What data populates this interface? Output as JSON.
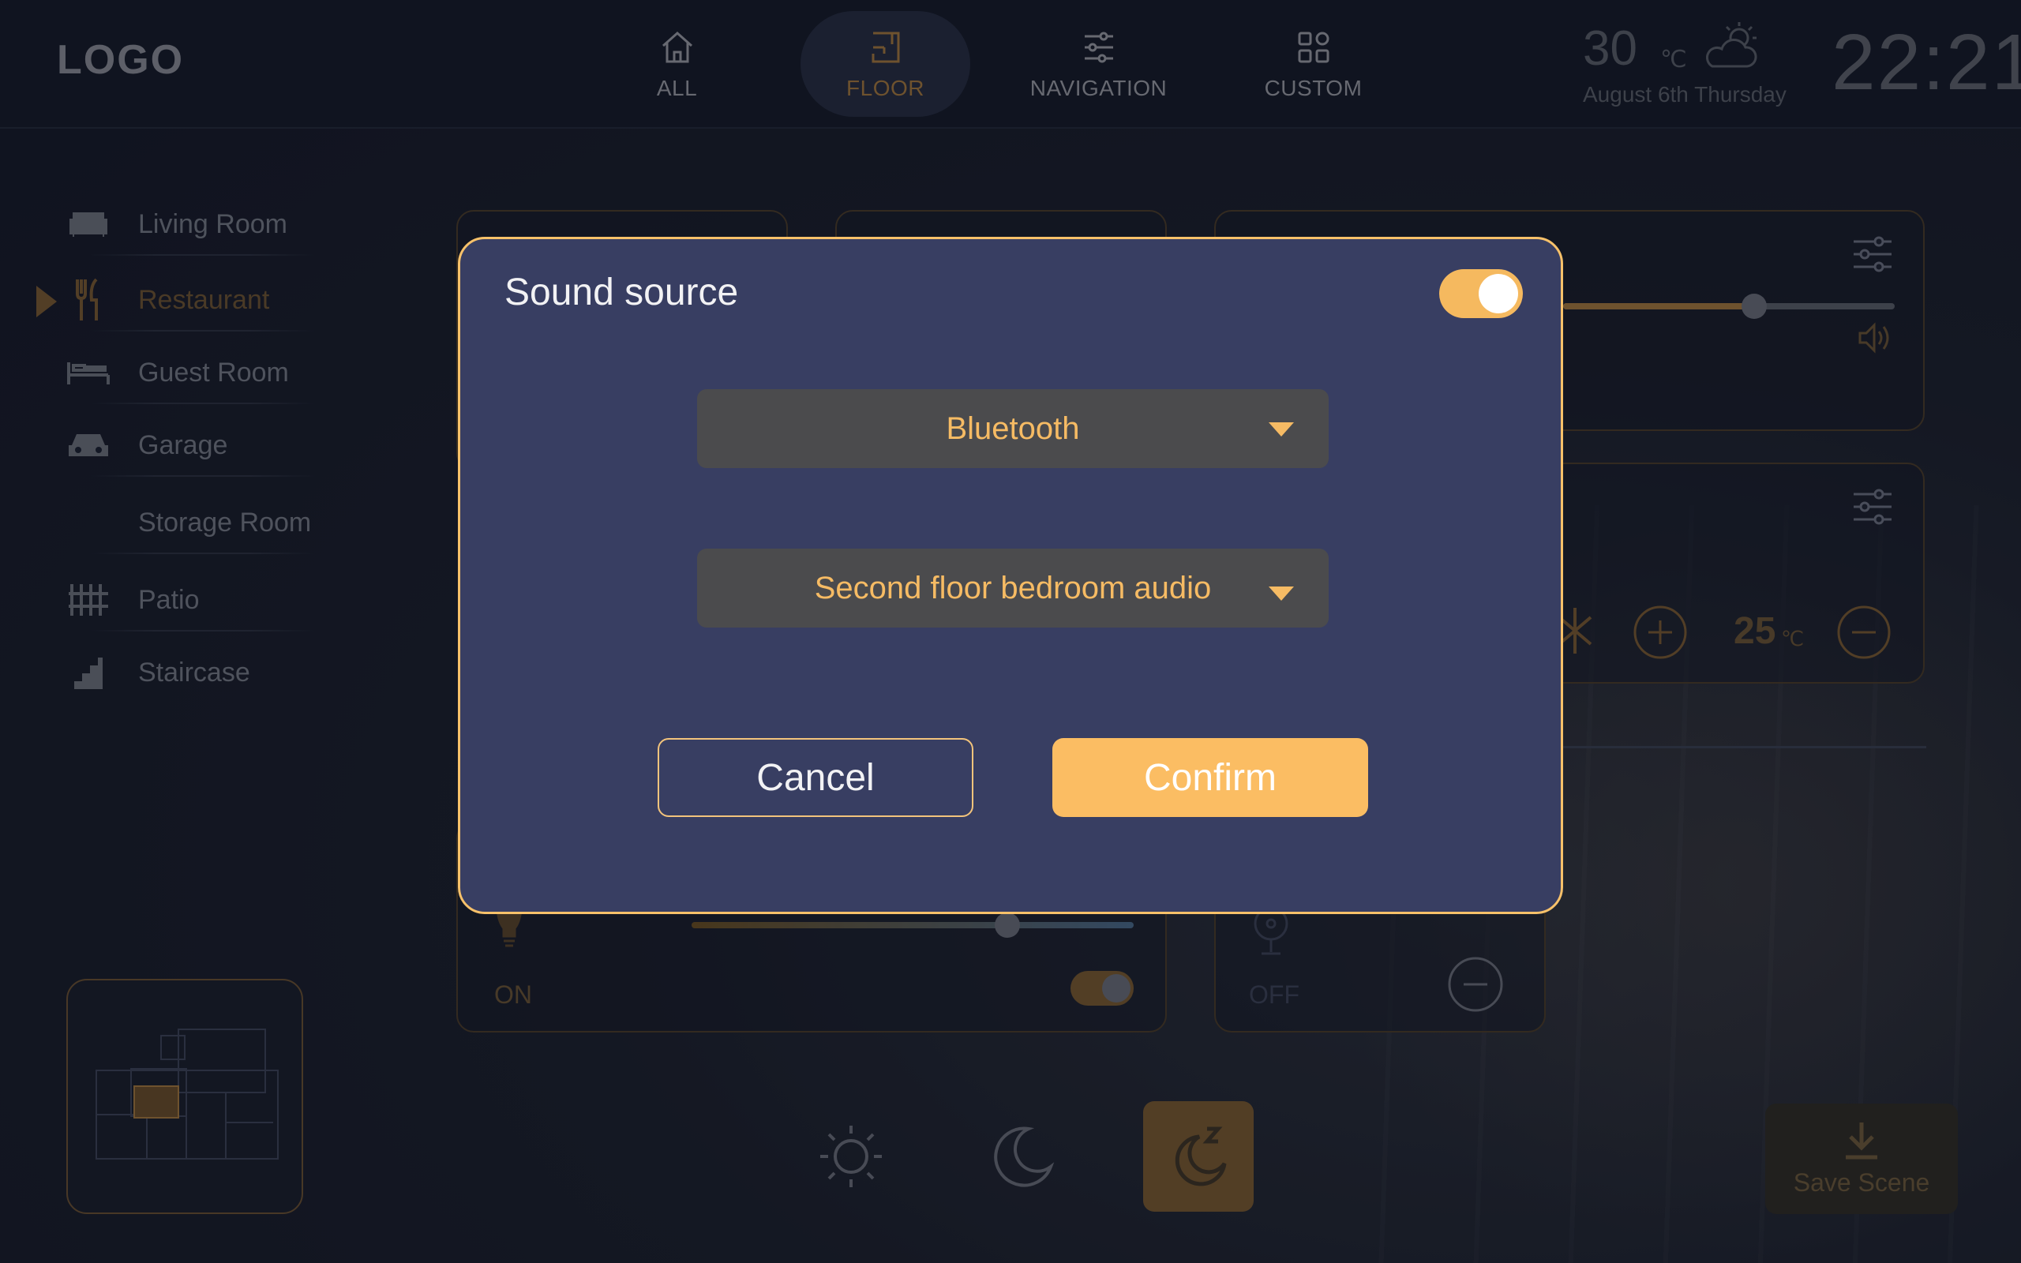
{
  "app": {
    "logo": "LOGO"
  },
  "nav": {
    "items": [
      {
        "label": "ALL",
        "icon": "home-icon",
        "active": false
      },
      {
        "label": "FLOOR",
        "icon": "floor-icon",
        "active": true
      },
      {
        "label": "NAVIGATION",
        "icon": "sliders-icon",
        "active": false
      },
      {
        "label": "CUSTOM",
        "icon": "grid-icon",
        "active": false
      }
    ]
  },
  "weather": {
    "temp": "30",
    "unit": "℃",
    "date": "August  6th  Thursday",
    "icon": "cloud-sun-icon"
  },
  "clock": {
    "time": "22:21"
  },
  "sidebar": {
    "rooms": [
      {
        "label": "Living Room",
        "icon": "sofa-icon"
      },
      {
        "label": "Restaurant",
        "icon": "fork-knife-icon",
        "active": true
      },
      {
        "label": "Guest Room",
        "icon": "bed-icon"
      },
      {
        "label": "Garage",
        "icon": "car-icon"
      },
      {
        "label": "Storage Room",
        "icon": ""
      },
      {
        "label": "Patio",
        "icon": "fence-icon"
      },
      {
        "label": "Staircase",
        "icon": "stairs-icon"
      }
    ]
  },
  "cards": {
    "light": {
      "status": "ON"
    },
    "fan": {
      "status": "OFF"
    },
    "climate": {
      "temp": "25",
      "unit": "℃"
    }
  },
  "scenes": {
    "save_label": "Save Scene"
  },
  "dialog": {
    "title": "Sound source",
    "toggle_on": true,
    "source_select": "Bluetooth",
    "device_select": "Second floor bedroom audio",
    "cancel_label": "Cancel",
    "confirm_label": "Confirm"
  },
  "colors": {
    "accent": "#fbbd63",
    "dialog_bg": "#383e62",
    "dialog_border": "#f7c16a",
    "dropdown_bg": "#4b4b4d"
  }
}
